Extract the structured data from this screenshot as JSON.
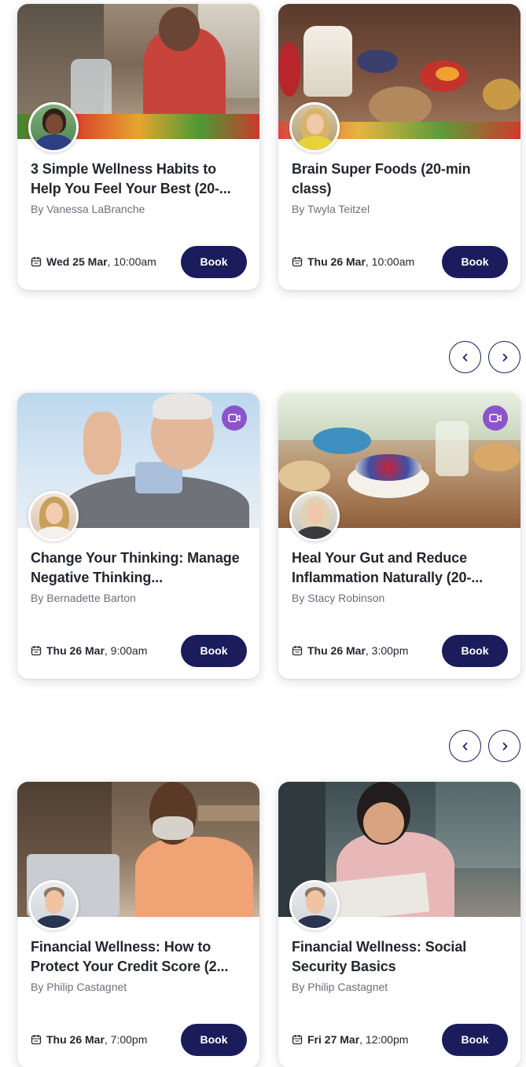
{
  "carousels": [
    {
      "cards": [
        {
          "title": "3 Simple Wellness Habits to Help You Feel Your Best (20-...",
          "author": "By Vanessa LaBranche",
          "day": "Wed 25 Mar",
          "time": ", 10:00am",
          "button": "Book"
        },
        {
          "title": "Brain Super Foods (20-min class)",
          "author": "By Twyla Teitzel",
          "day": "Thu 26 Mar",
          "time": ", 10:00am",
          "button": "Book"
        }
      ]
    },
    {
      "cards": [
        {
          "title": "Change Your Thinking: Manage Negative Thinking...",
          "author": "By Bernadette Barton",
          "day": "Thu 26 Mar",
          "time": ", 9:00am",
          "button": "Book"
        },
        {
          "title": "Heal Your Gut and Reduce Inflammation Naturally (20-...",
          "author": "By Stacy Robinson",
          "day": "Thu 26 Mar",
          "time": ", 3:00pm",
          "button": "Book"
        }
      ]
    },
    {
      "cards": [
        {
          "title": "Financial Wellness: How to Protect Your Credit Score (2...",
          "author": "By Philip Castagnet",
          "day": "Thu 26 Mar",
          "time": ", 7:00pm",
          "button": "Book"
        },
        {
          "title": "Financial Wellness: Social Security Basics",
          "author": "By Philip Castagnet",
          "day": "Fri 27 Mar",
          "time": ", 12:00pm",
          "button": "Book"
        }
      ]
    }
  ],
  "icons": {
    "calendar": "calendar-icon",
    "video": "video-camera-icon",
    "prev": "chevron-left-icon",
    "next": "chevron-right-icon"
  },
  "colors": {
    "button": "#1b1c5c",
    "video_badge": "#8b54c9",
    "text": "#23262f",
    "muted": "#6b6f7a"
  }
}
